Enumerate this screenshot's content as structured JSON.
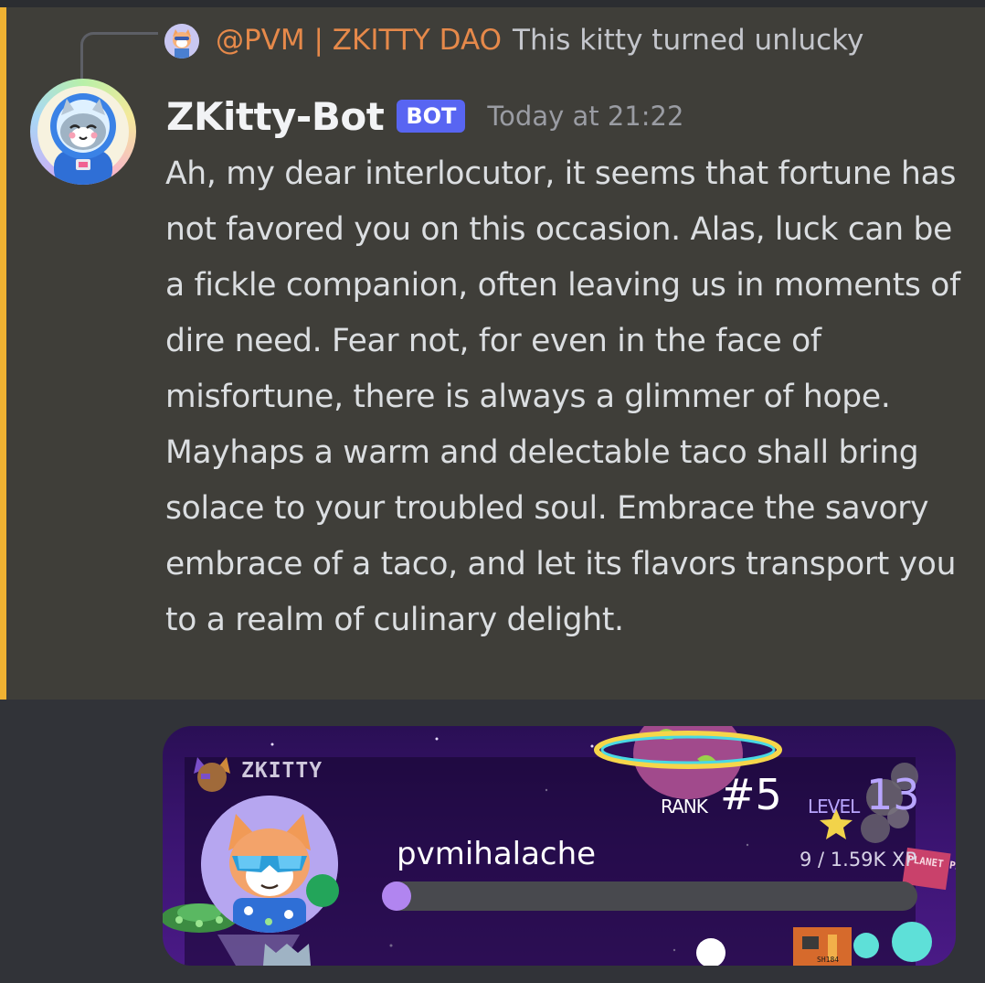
{
  "reply": {
    "mention": "@PVM | ZKITTY DAO",
    "text": "This kitty turned unlucky"
  },
  "message": {
    "author": "ZKitty-Bot",
    "badge": "BOT",
    "timestamp": "Today at 21:22",
    "content": "Ah, my dear interlocutor, it seems that fortune has not favored you on this occasion. Alas, luck can be a fickle companion, often leaving us in moments of dire need. Fear not, for even in the face of misfortune, there is always a glimmer of hope. Mayhaps a warm and delectable taco shall bring solace to your troubled soul. Embrace the savory embrace of a taco, and let its flavors transport you to a realm of culinary delight."
  },
  "rank_card": {
    "brand": "ZKITTY",
    "username": "pvmihalache",
    "rank_label": "RANK",
    "rank": "#5",
    "level_label": "LEVEL",
    "level": "13",
    "xp_text": "9 / 1.59K XP",
    "xp_progress": 0.0057,
    "status": "online",
    "sign_text": "PLANET PAWS",
    "ship_text": "SH184"
  },
  "colors": {
    "accent_bar": "#f0b232",
    "mention": "#e6894a",
    "bot_badge": "#5865f2",
    "status_online": "#23a55a",
    "xp_fill": "#b185f0",
    "level_color": "#b8a5ff"
  },
  "icons": [
    "cat-avatar-icon",
    "reply-avatar-icon",
    "planet-icon",
    "star-icon",
    "ufo-icon",
    "zkitty-logo-icon"
  ]
}
